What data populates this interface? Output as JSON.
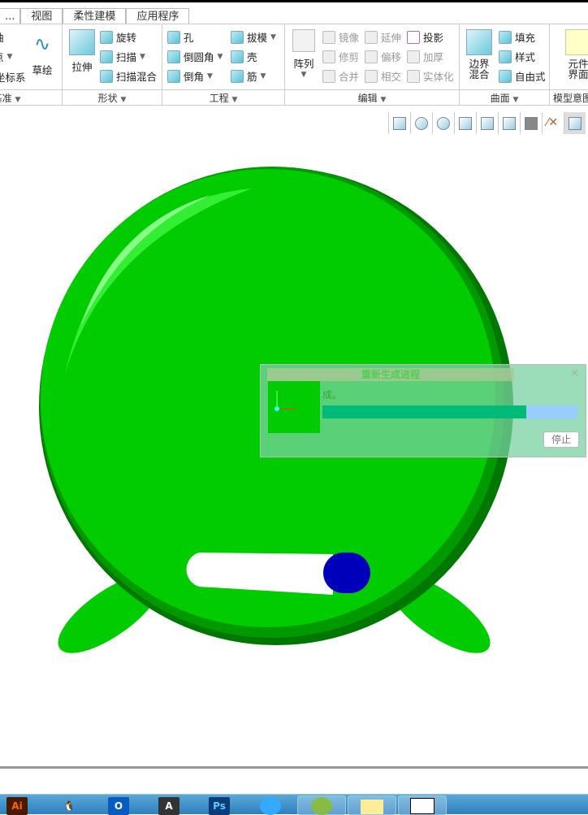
{
  "tabs": [
    "...",
    "视图",
    "柔性建模",
    "应用程序"
  ],
  "ribbon": {
    "g1": {
      "items": [
        "轴",
        "点",
        "坐标系"
      ],
      "label": "基准"
    },
    "g2": {
      "sketch": "草绘",
      "extrude": "拉伸",
      "revolve": "旋转",
      "sweep": "扫描",
      "swept_blend": "扫描混合",
      "label": "形状"
    },
    "g3": {
      "hole": "孔",
      "round": "倒圆角",
      "chamfer": "倒角",
      "draft": "拔模",
      "shell": "壳",
      "rib": "筋",
      "label": "工程"
    },
    "g4": {
      "pattern": "阵列",
      "mirror": "镜像",
      "trim": "修剪",
      "merge": "合并",
      "extend": "延伸",
      "offset": "偏移",
      "intersect": "相交",
      "project": "投影",
      "thicken": "加厚",
      "solidify": "实体化",
      "label": "编辑"
    },
    "g5": {
      "boundary_blend": "边界混合",
      "fill": "填充",
      "style": "样式",
      "freestyle": "自由式",
      "label": "曲面"
    },
    "g6": {
      "component_interface": "元件界面",
      "label": "模型意图"
    }
  },
  "view_toolbar": [
    "zoom-fit-icon",
    "zoom-in-icon",
    "zoom-out-icon",
    "repaint-icon",
    "view-orient-icon",
    "saved-views-icon",
    "display-style-icon",
    "datum-display-icon",
    "spin-center-icon"
  ],
  "dialog": {
    "title": "重新生成进程",
    "message": "成。",
    "close": "×",
    "stop": "停止",
    "progress": 0.8
  },
  "colors": {
    "model": "#00cc00",
    "model_dark": "#008800",
    "blue": "#0000bb"
  },
  "taskbar": {
    "apps": [
      "Ai",
      "QQ",
      "Outlook",
      "Autodesk",
      "Ps",
      "Browser",
      "Creo",
      "Explorer",
      "File"
    ]
  }
}
